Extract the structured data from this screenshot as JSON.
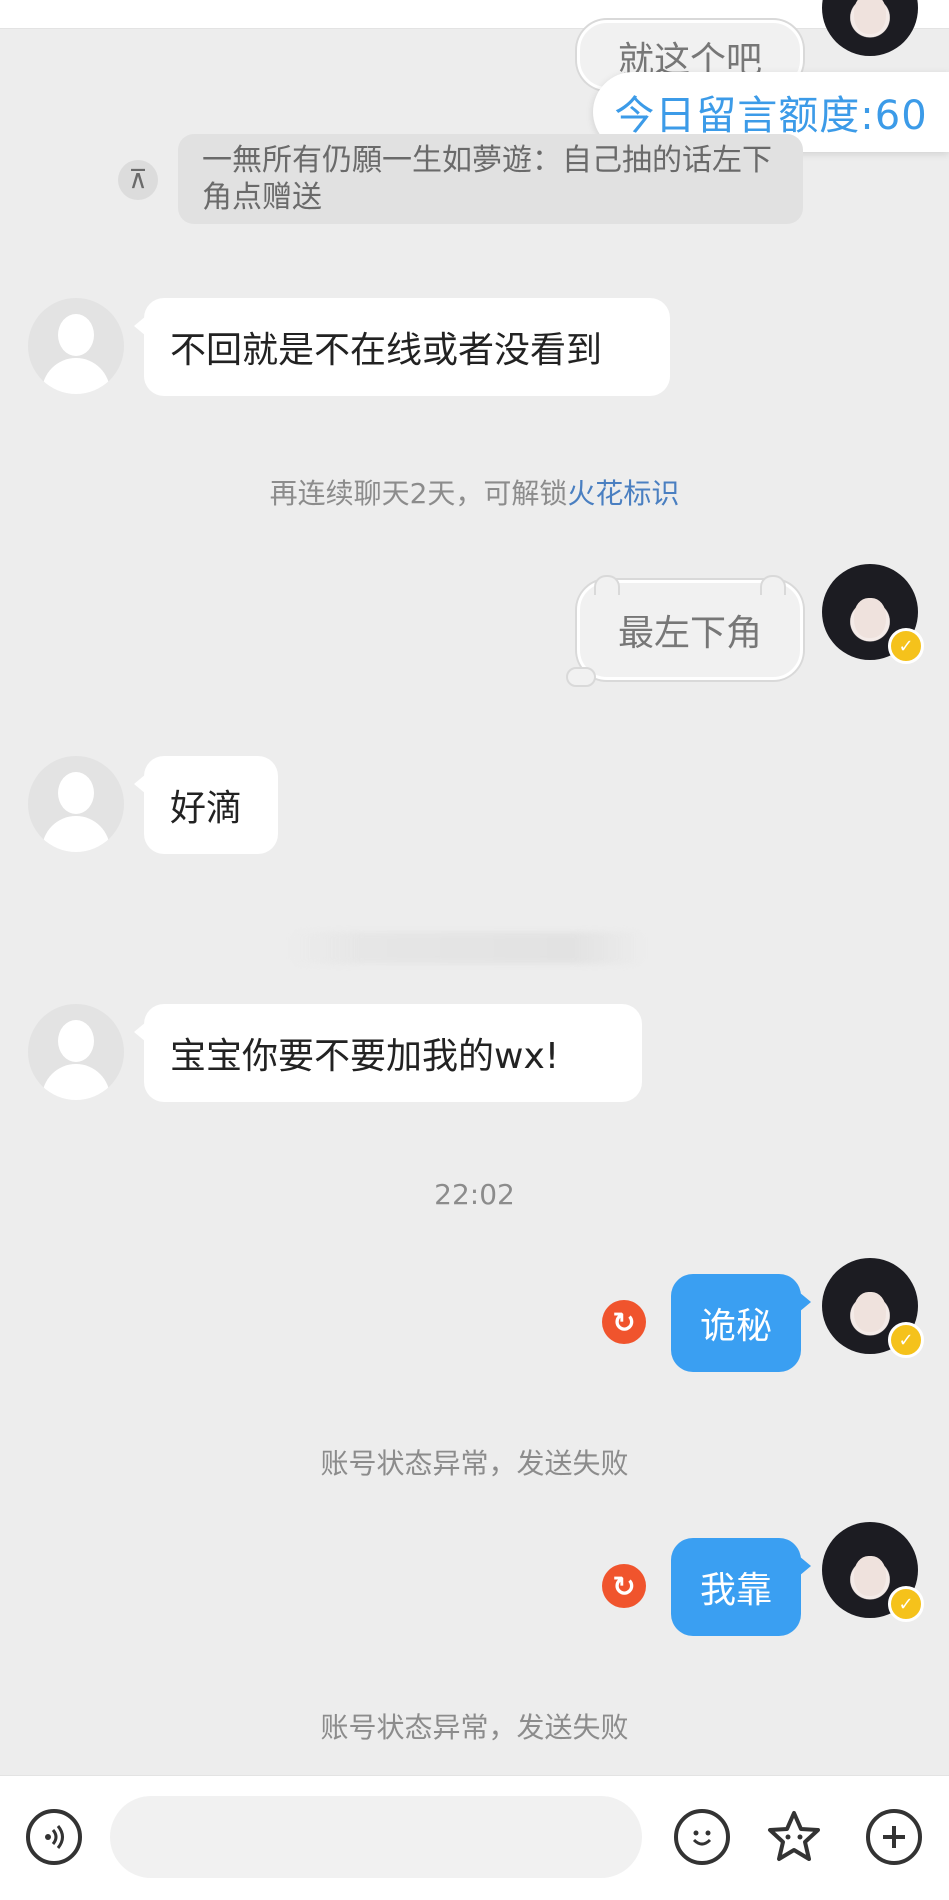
{
  "quota": {
    "label": "今日留言额度:60"
  },
  "partial_top": {
    "text": "就这个吧"
  },
  "pinned": {
    "text": "一無所有仍願一生如夢遊：自己抽的话左下角点赠送"
  },
  "messages": {
    "m1": "不回就是不在线或者没看到",
    "m2": "最左下角",
    "m3": "好滴",
    "m4": "宝宝你要不要加我的wx!",
    "m5": "诡秘",
    "m6": "我靠"
  },
  "system": {
    "streak_prefix": "再连续聊天2天，可解锁",
    "streak_link": "火花标识",
    "failed_1": "账号状态异常，发送失败",
    "failed_2": "账号状态异常，发送失败"
  },
  "time": {
    "t1": "22:02"
  },
  "icons": {
    "pin": "pin-top-icon",
    "retry": "retry-icon",
    "voice": "voice-icon",
    "emoji": "emoji-icon",
    "sticker": "sticker-icon",
    "plus": "plus-icon",
    "verified": "verified-badge-icon"
  },
  "colors": {
    "accent_blue": "#3a9ff2",
    "link_blue": "#4a7fc1",
    "error_red": "#f0542d",
    "badge_gold": "#f5c21b"
  },
  "input": {
    "placeholder": ""
  }
}
